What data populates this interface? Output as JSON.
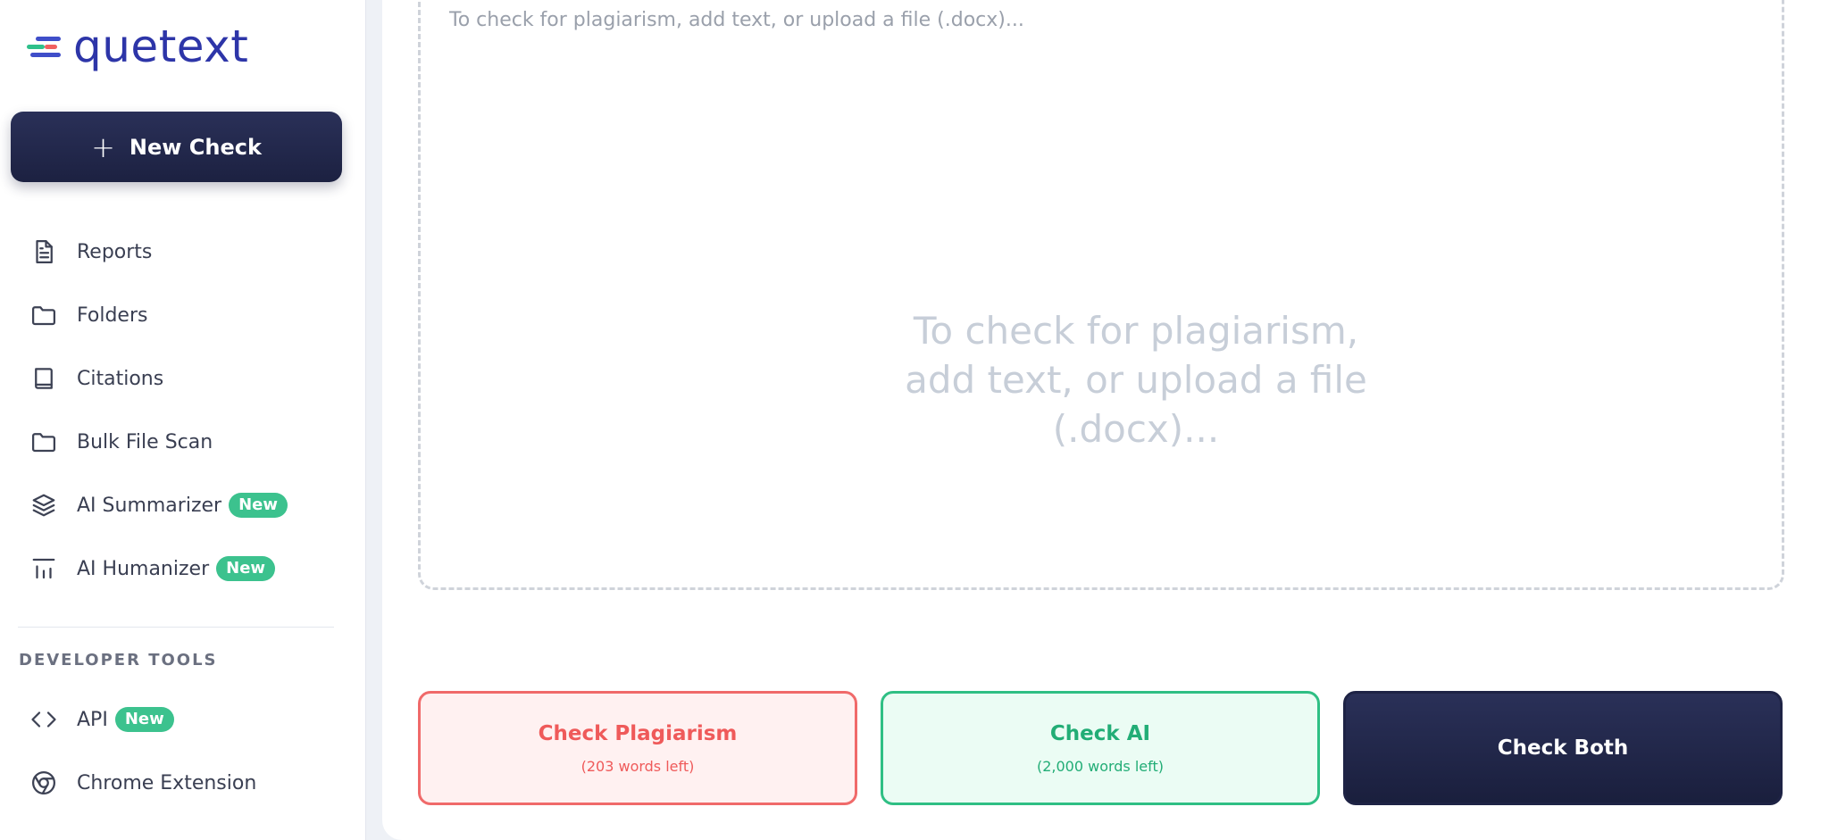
{
  "sidebar": {
    "logo_text": "quetext",
    "new_check_label": "New Check",
    "items": [
      {
        "label": "Reports",
        "icon": "document-icon"
      },
      {
        "label": "Folders",
        "icon": "folder-icon"
      },
      {
        "label": "Citations",
        "icon": "book-icon"
      },
      {
        "label": "Bulk File Scan",
        "icon": "folder-icon"
      },
      {
        "label": "AI Summarizer",
        "icon": "layers-icon",
        "badge": "New"
      },
      {
        "label": "AI Humanizer",
        "icon": "bars-icon",
        "badge": "New"
      }
    ],
    "developer_section_label": "DEVELOPER TOOLS",
    "developer_items": [
      {
        "label": "API",
        "icon": "code-icon",
        "badge": "New"
      },
      {
        "label": "Chrome Extension",
        "icon": "chrome-icon"
      }
    ]
  },
  "editor": {
    "placeholder_small": "To check for plagiarism, add text, or upload a file (.docx)...",
    "placeholder_big": "To check for plagiarism, add text, or upload a file (.docx)..."
  },
  "actions": {
    "check_plagiarism": {
      "label": "Check Plagiarism",
      "sub": "(203 words left)"
    },
    "check_ai": {
      "label": "Check AI",
      "sub": "(2,000 words left)"
    },
    "check_both": {
      "label": "Check Both"
    }
  },
  "colors": {
    "brand_dark": "#1c2141",
    "logo_blue": "#2d35a8",
    "accent_green": "#3cc28e",
    "accent_red": "#f06a6a"
  }
}
